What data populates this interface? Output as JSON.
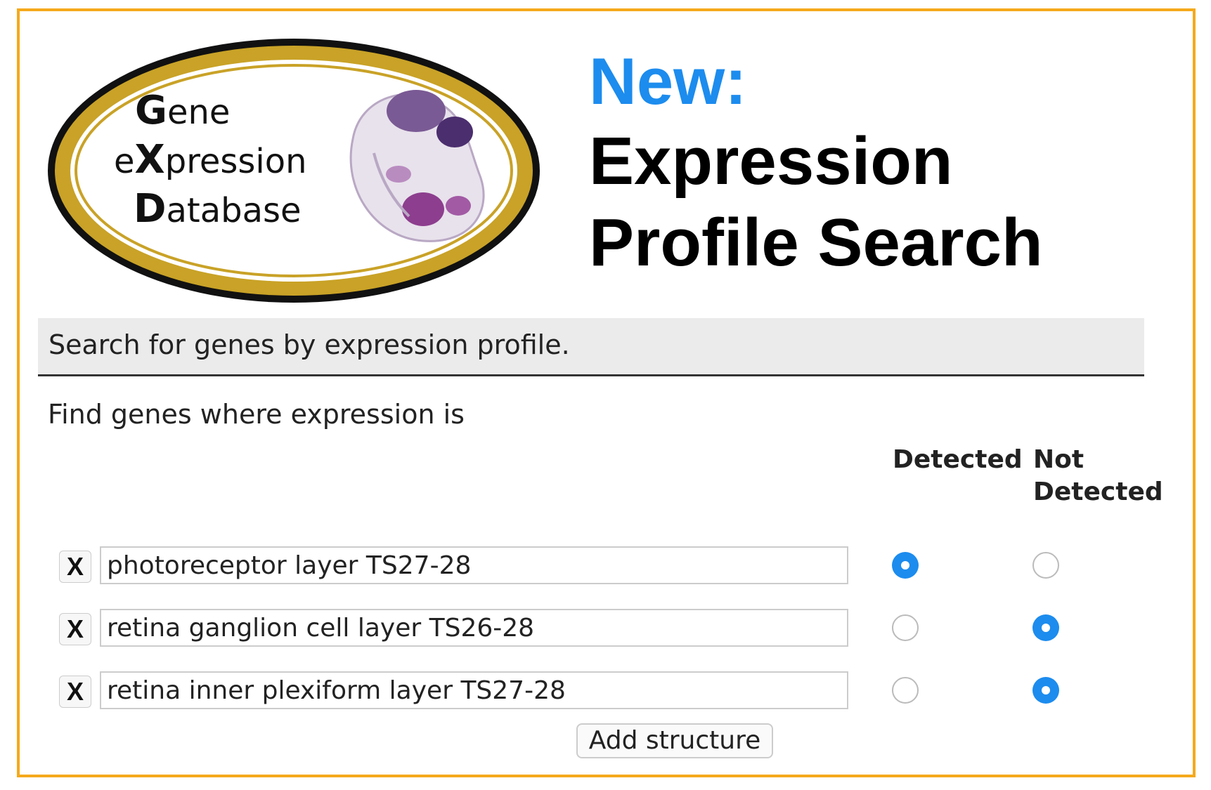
{
  "logo": {
    "line1_cap": "G",
    "line1_rest": "ene",
    "line2_pre": "e",
    "line2_cap": "X",
    "line2_rest": "pression",
    "line3_cap": "D",
    "line3_rest": "atabase",
    "ring_color": "#C9A227",
    "embryo_icon": "embryo-image"
  },
  "headline": {
    "new_label": "New:",
    "title_line1": "Expression",
    "title_line2": "Profile Search",
    "accent_color": "#1C8CEE"
  },
  "banner": {
    "text": "Search for genes by expression profile."
  },
  "form": {
    "intro": "Find genes where expression is",
    "col_detected": "Detected",
    "col_not_detected_1": "Not",
    "col_not_detected_2": "Detected",
    "remove_label": "X",
    "rows": [
      {
        "structure": "photoreceptor layer TS27-28",
        "selected": "Detected"
      },
      {
        "structure": "retina ganglion cell layer TS26-28",
        "selected": "Not Detected"
      },
      {
        "structure": "retina inner plexiform layer TS27-28",
        "selected": "Not Detected"
      }
    ],
    "add_button": "Add structure"
  }
}
